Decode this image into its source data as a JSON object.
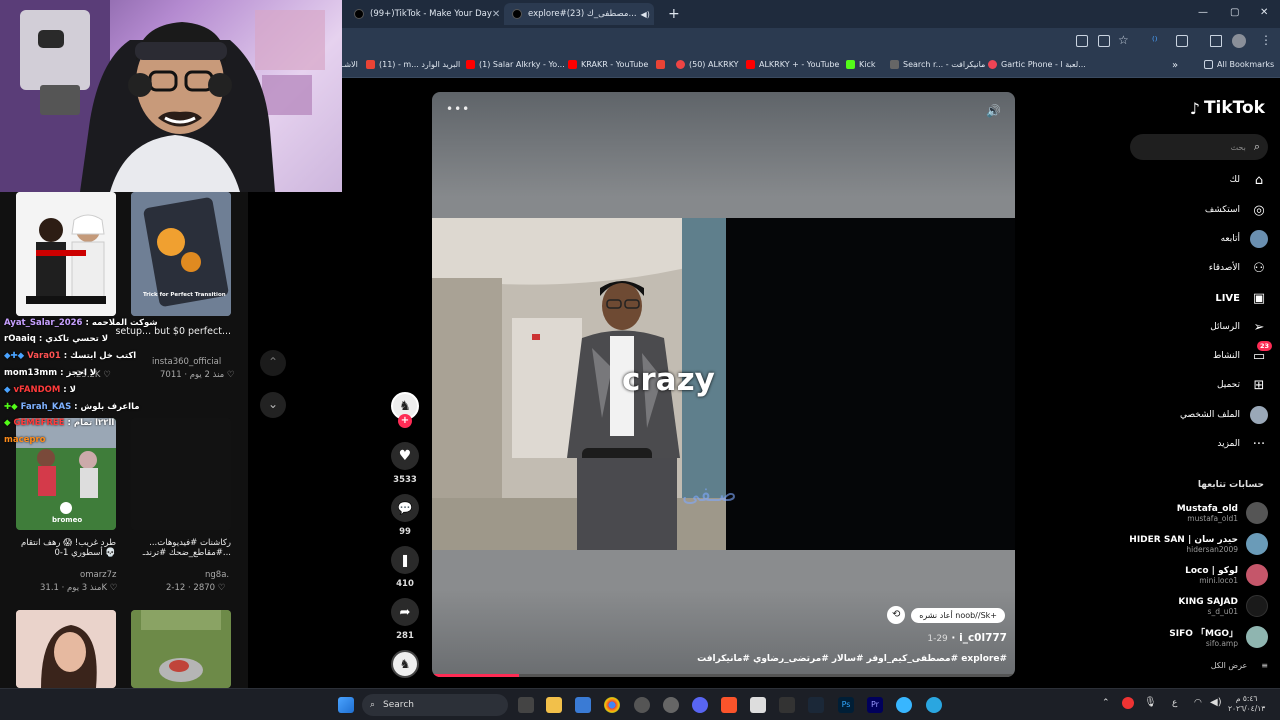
{
  "browser": {
    "tabs": [
      {
        "title": "(99+)TikTok - Make Your Day",
        "close": "✕"
      },
      {
        "title": "explore#(23) مصطفى_ك...",
        "close": "✕"
      }
    ],
    "new_tab": "+",
    "window_controls": {
      "minimize": "—",
      "maximize": "▢",
      "close": "✕"
    },
    "bookmarks": [
      {
        "label": "الاشـ",
        "color": "#666"
      },
      {
        "label": "(11) - m... البريد الوارد",
        "color": "#ea4335"
      },
      {
        "label": "(1) Salar Alkrky - Yo...",
        "color": "#ff0000"
      },
      {
        "label": "KRAKR - YouTube",
        "color": "#ff0000"
      },
      {
        "label": "(50) ALKRKY",
        "color": "#e44"
      },
      {
        "label": "ALKRKY + - YouTube",
        "color": "#ff0000"
      },
      {
        "label": "Kick",
        "color": "#53fc18"
      },
      {
        "label": "Search r... - مانيكرافت",
        "color": "#888"
      },
      {
        "label": "Gartic Phone - لعبة ا...",
        "color": "#e45"
      }
    ],
    "more_bookmarks": "»",
    "all_bookmarks": "All Bookmarks"
  },
  "left_feed": {
    "videos": [
      {
        "caption": "setup... but $0 perfect...",
        "author": "insta360_official",
        "date": "منذ 2 يوم",
        "likes": "7011"
      },
      {
        "caption": "...ركاشنات #فيديوهات #مقاطع_ضحك #ترندـ...",
        "author": "ng8a.",
        "date": "2-12",
        "likes": "2870"
      },
      {
        "caption": "طرد غريب! 😱 رهف انتقام أسطوري 1-0 💀",
        "author": "omarz7z",
        "date": "منذ 3 يوم",
        "likes": "31.1K"
      }
    ],
    "like_23k": "23.2K",
    "thumb_text": "Trick for Perfect Transition",
    "thumb_watermark": "bromeo",
    "chat": [
      {
        "user": "Ayat_Salar_2026",
        "msg": "شوكت الملاحمه",
        "color": "#c7a0ff"
      },
      {
        "user": "rOaaiq",
        "msg": "لا تحسي تاكدي",
        "color": "#ffffff"
      },
      {
        "user": "Vara01",
        "msg": "اكتب خل ابتسك",
        "color": "#ff5252"
      },
      {
        "user": "mom13mm",
        "msg": "لا احجز",
        "color": "#ffffff"
      },
      {
        "user": "vFANDOM",
        "msg": "لا",
        "color": "#ff3b3b"
      },
      {
        "user": "Farah_KAS",
        "msg": "مااعرف بلوش",
        "color": "#7fb2ff"
      },
      {
        "user": "GEMEFREE",
        "msg": "اا٢٢ا تمام",
        "color": "#ff3b3b"
      },
      {
        "user": "macepro",
        "msg": "",
        "color": "#ff8c1a"
      }
    ]
  },
  "nav": {
    "up": "⌃",
    "down": "⌄"
  },
  "video": {
    "overlay_text": "crazy",
    "signature": "صـفى",
    "more": "•••",
    "volume": "🔊",
    "repost_label": "أعاد نشره noob//Sk+",
    "author_handle": "i_c0l777",
    "date": "1-29",
    "hashtags": "#explore #مصطفى_كيم_اوفر #سالار #مرتضى_رضاوي #مانيكرافت",
    "progress": 0.15
  },
  "actions": {
    "likes": "3533",
    "comments": "99",
    "saves": "410",
    "shares": "281",
    "follow": "+"
  },
  "sidebar": {
    "logo": "TikTok",
    "search_placeholder": "بحث",
    "nav": [
      {
        "label": "لك",
        "icon": "home-icon",
        "glyph": "⌂"
      },
      {
        "label": "استكشف",
        "icon": "compass-icon",
        "glyph": "◎"
      },
      {
        "label": "أتابعه",
        "icon": "avatar",
        "glyph": ""
      },
      {
        "label": "الأصدقاء",
        "icon": "friends-icon",
        "glyph": "⚇"
      },
      {
        "label": "LIVE",
        "icon": "live-icon",
        "glyph": "▣"
      },
      {
        "label": "الرسائل",
        "icon": "messages-icon",
        "glyph": "➢"
      },
      {
        "label": "النشاط",
        "icon": "activity-icon",
        "glyph": "▭",
        "badge": "23"
      },
      {
        "label": "تحميل",
        "icon": "upload-icon",
        "glyph": "⊞"
      },
      {
        "label": "الملف الشخصي",
        "icon": "profile-icon",
        "glyph": ""
      },
      {
        "label": "المزيد",
        "icon": "more-icon",
        "glyph": "···"
      }
    ],
    "following_title": "حسابات تتابعها",
    "accounts": [
      {
        "name": "Mustafa_old",
        "user": "mustafa_old1",
        "color": "#666"
      },
      {
        "name": "HIDER SAN | حيدر سان",
        "user": "hidersan2009",
        "color": "#7ab"
      },
      {
        "name": "Loco | لوكو",
        "user": "mini.loco1",
        "color": "#c56"
      },
      {
        "name": "KING SAJAD",
        "user": "s_d_u01",
        "color": "#222"
      },
      {
        "name": "SIFO 「MGO」",
        "user": "sifo.amp",
        "color": "#9bb"
      }
    ],
    "see_all": "عرض الكل"
  },
  "taskbar": {
    "search_label": "Search",
    "time": "٥:٤٦ م",
    "date": "٢٠٢٦/٠٤/١٣",
    "lang": "ع"
  }
}
